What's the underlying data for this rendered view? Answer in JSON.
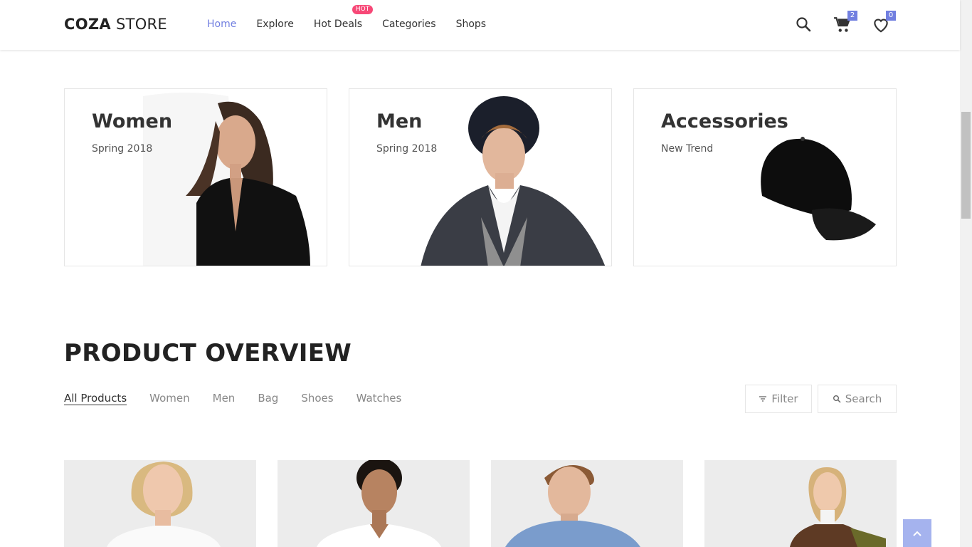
{
  "header": {
    "logo_bold": "COZA",
    "logo_light": "STORE",
    "nav": [
      {
        "label": "Home",
        "active": true
      },
      {
        "label": "Explore"
      },
      {
        "label": "Hot Deals",
        "badge": "HOT"
      },
      {
        "label": "Categories"
      },
      {
        "label": "Shops"
      }
    ],
    "cart_count": "2",
    "wishlist_count": "0",
    "icons": [
      "search-icon",
      "cart-icon",
      "heart-icon"
    ]
  },
  "banners": [
    {
      "title": "Women",
      "subtitle": "Spring 2018"
    },
    {
      "title": "Men",
      "subtitle": "Spring 2018"
    },
    {
      "title": "Accessories",
      "subtitle": "New Trend"
    }
  ],
  "overview": {
    "title": "PRODUCT OVERVIEW",
    "tabs": [
      "All Products",
      "Women",
      "Men",
      "Bag",
      "Shoes",
      "Watches"
    ],
    "filter_label": "Filter",
    "search_label": "Search"
  },
  "colors": {
    "accent": "#717fe0",
    "hot_badge": "#f74877",
    "back_to_top": "#a5b3ee"
  }
}
